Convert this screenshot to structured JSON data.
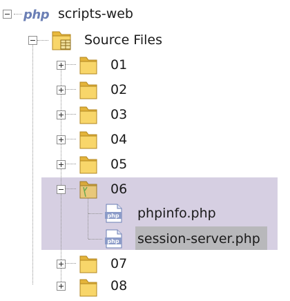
{
  "project": {
    "name": "scripts-web",
    "logo_text": "php"
  },
  "source_files": {
    "label": "Source Files"
  },
  "folders": [
    {
      "label": "01",
      "expanded": false
    },
    {
      "label": "02",
      "expanded": false
    },
    {
      "label": "03",
      "expanded": false
    },
    {
      "label": "04",
      "expanded": false
    },
    {
      "label": "05",
      "expanded": false
    },
    {
      "label": "06",
      "expanded": true,
      "children": [
        {
          "label": "phpinfo.php",
          "selected": false
        },
        {
          "label": "session-server.php",
          "selected": true
        }
      ]
    },
    {
      "label": "07",
      "expanded": false
    },
    {
      "label": "08",
      "expanded": false
    }
  ],
  "colors": {
    "selection_band": "#d6cfe2",
    "selected_item": "#b8b8bb",
    "folder": "#f2c94c",
    "php_blue": "#6b7fb5"
  }
}
